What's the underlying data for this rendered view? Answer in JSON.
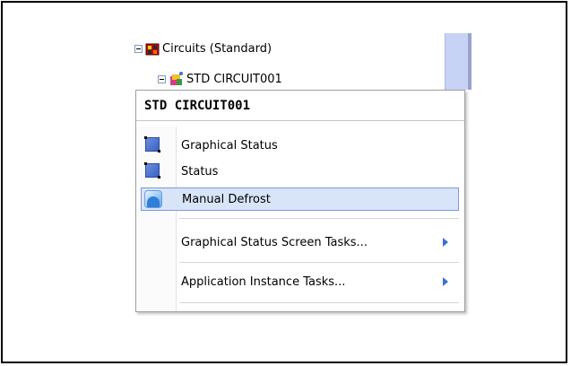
{
  "tree": {
    "circuits_label": "Circuits (Standard)",
    "std_label": "STD CIRCUIT001"
  },
  "menu": {
    "title": "STD CIRCUIT001",
    "items": [
      {
        "label": "Graphical Status",
        "icon": "graphical-status-icon"
      },
      {
        "label": "Status",
        "icon": "status-icon"
      },
      {
        "label": "Manual Defrost",
        "icon": "manual-defrost-icon",
        "highlighted": true
      },
      {
        "label": "Graphical Status Screen Tasks...",
        "submenu": true
      },
      {
        "label": "Application Instance Tasks...",
        "submenu": true
      }
    ]
  },
  "colors": {
    "highlight_bg": "#d8e4f8",
    "highlight_border": "#7a9bd8",
    "submenu_arrow": "#3a6fd8"
  }
}
